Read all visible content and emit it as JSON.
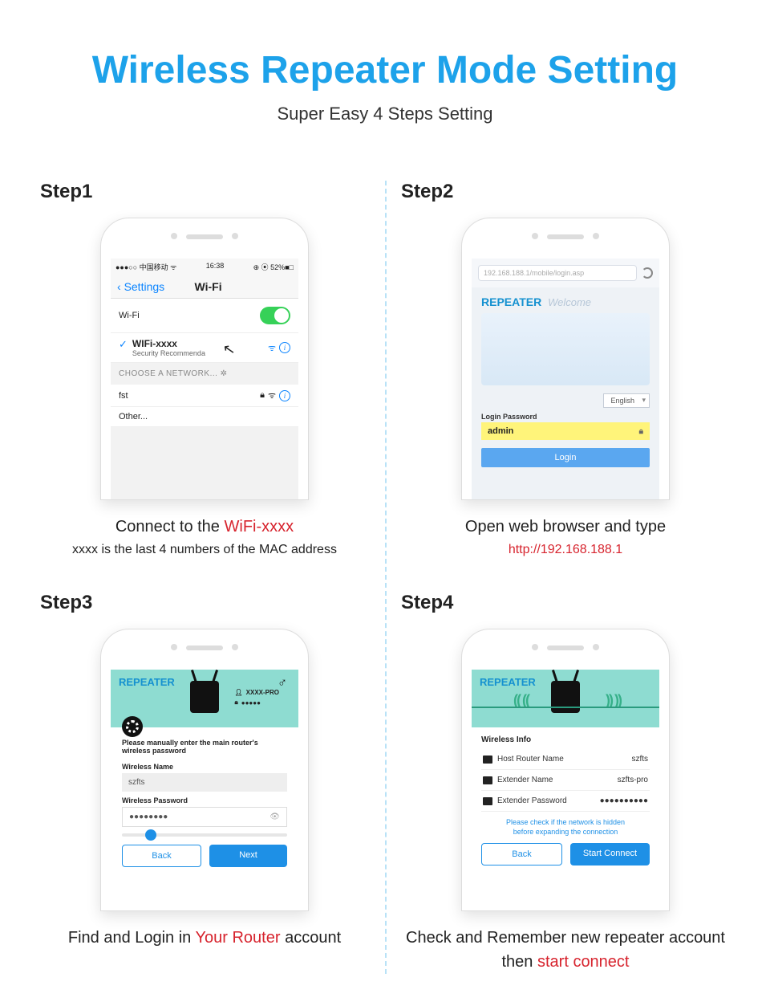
{
  "title": "Wireless Repeater Mode Setting",
  "subtitle": "Super Easy 4 Steps Setting",
  "steps": {
    "s1": {
      "label": "Step1",
      "statusbar": {
        "left": "●●●○○ 中国移动 ᯤ",
        "time": "16:38",
        "right": "⊕ ⦿ 52%■□"
      },
      "nav": {
        "back": "Settings",
        "title": "Wi-Fi"
      },
      "wifi_label": "Wi-Fi",
      "connected": {
        "name": "WIFi-xxxx",
        "sub": "Security Recommenda"
      },
      "choose_header": "CHOOSE A NETWORK...",
      "net1": "fst",
      "other": "Other...",
      "caption_pre": "Connect to the ",
      "caption_red": "WiFi-xxxx",
      "caption_sub": "xxxx is the last 4 numbers of the MAC address"
    },
    "s2": {
      "label": "Step2",
      "url": "192.168.188.1/mobile/login.asp",
      "brand": "REPEATER",
      "welcome": "Welcome",
      "lang": "English",
      "pw_label": "Login Password",
      "pw_value": "admin",
      "login_btn": "Login",
      "caption_pre": "Open web browser and type",
      "caption_red": "http://192.168.188.1"
    },
    "s3": {
      "label": "Step3",
      "brand": "REPEATER",
      "kv1": "XXXX-PRO",
      "kv2": "●●●●●",
      "hint": "Please manually enter the main router's wireless password",
      "name_label": "Wireless Name",
      "name_value": "szfts",
      "pw_label": "Wireless Password",
      "pw_value": "●●●●●●●●",
      "back_btn": "Back",
      "next_btn": "Next",
      "caption_pre": "Find and Login in ",
      "caption_red": "Your Router",
      "caption_post": " account"
    },
    "s4": {
      "label": "Step4",
      "brand": "REPEATER",
      "info_title": "Wireless Info",
      "rows": [
        {
          "label": "Host Router Name",
          "value": "szfts"
        },
        {
          "label": "Extender Name",
          "value": "szfts-pro"
        },
        {
          "label": "Extender Password",
          "value": "●●●●●●●●●●"
        }
      ],
      "note": "Please check if the network is hidden before expanding the connection",
      "back_btn": "Back",
      "start_btn": "Start Connect",
      "caption_pre": "Check and Remember new repeater account then ",
      "caption_red": "start connect"
    }
  }
}
